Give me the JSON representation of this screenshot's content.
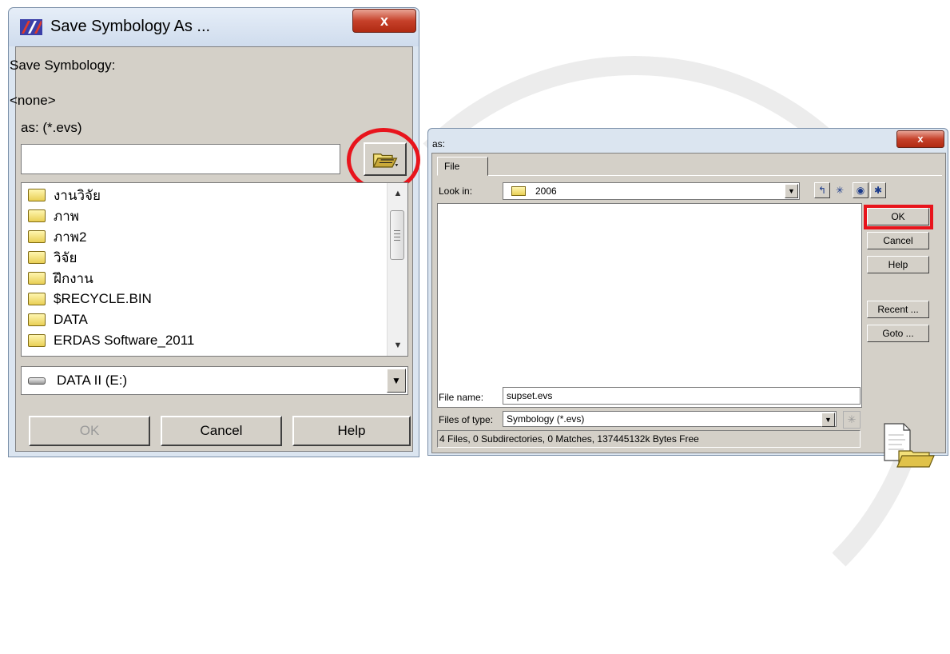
{
  "dialog1": {
    "title": "Save Symbology As ...",
    "close_label": "x",
    "label_save": "Save Symbology:",
    "label_none": "<none>",
    "label_as": "as: (*.evs)",
    "input_value": "",
    "folders": [
      "งานวิจัย",
      "ภาพ",
      "ภาพ2",
      "วิจัย",
      "ฝึกงาน",
      "$RECYCLE.BIN",
      "DATA",
      "ERDAS Software_2011"
    ],
    "drive": "DATA II (E:)",
    "buttons": {
      "ok": "OK",
      "cancel": "Cancel",
      "help": "Help"
    }
  },
  "dialog2": {
    "title": "as:",
    "close_label": "x",
    "tab": "File",
    "look_in_label": "Look in:",
    "look_in_value": "2006",
    "buttons": {
      "ok": "OK",
      "cancel": "Cancel",
      "help": "Help",
      "recent": "Recent ...",
      "goto": "Goto ..."
    },
    "file_name_label": "File name:",
    "file_name_value": "supset.evs",
    "file_type_label": "Files of type:",
    "file_type_value": "Symbology (*.evs)",
    "status": "4 Files, 0 Subdirectories, 0 Matches, 137445132k Bytes Free"
  },
  "colors": {
    "highlight_red": "#e8141c",
    "title_bar": "#dbe5f0",
    "dialog_face": "#d4d0c8"
  }
}
